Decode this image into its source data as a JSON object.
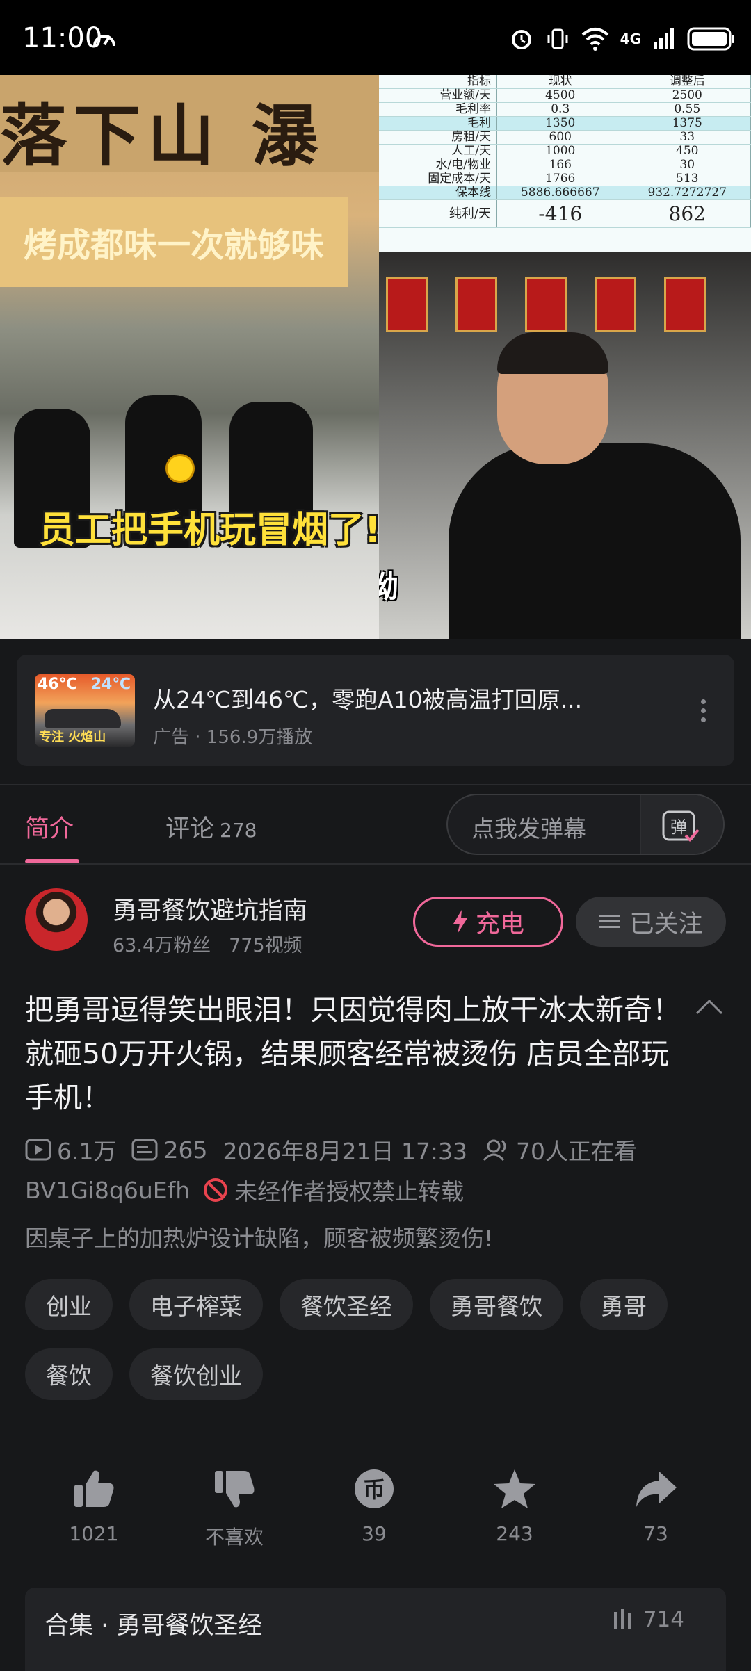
{
  "status_bar": {
    "time": "11:00",
    "network": "4G"
  },
  "video": {
    "left_sign_text": "落下山 瀑",
    "left_banner_text": "烤成都味一次就够味",
    "left_subtitle": "员工把手机玩冒烟了!",
    "right_caption": "哎呦",
    "table": {
      "headers": [
        "指标",
        "现状",
        "调整后"
      ],
      "rows": [
        [
          "营业额/天",
          "4500",
          "2500"
        ],
        [
          "毛利率",
          "0.3",
          "0.55"
        ],
        [
          "毛利",
          "1350",
          "1375"
        ],
        [
          "房租/天",
          "600",
          "33"
        ],
        [
          "人工/天",
          "1000",
          "450"
        ],
        [
          "水/电/物业",
          "166",
          "30"
        ],
        [
          "固定成本/天",
          "1766",
          "513"
        ],
        [
          "保本线",
          "5886.666667",
          "932.7272727"
        ],
        [
          "纯利/天",
          "-416",
          "862"
        ]
      ]
    }
  },
  "ad": {
    "thumb_temp_hot": "46℃",
    "thumb_temp_cool": "24℃",
    "thumb_caption": "专注 火焰山",
    "title": "从24℃到46℃，零跑A10被高温打回原...",
    "subtitle": "广告 · 156.9万播放"
  },
  "tabs": {
    "intro": "简介",
    "comments": "评论",
    "comments_count": "278",
    "danmu_placeholder": "点我发弹幕"
  },
  "author": {
    "name": "勇哥餐饮避坑指南",
    "fans": "63.4万粉丝",
    "videos": "775视频",
    "charge_label": "充电",
    "follow_label": "已关注"
  },
  "video_info": {
    "title": "把勇哥逗得笑出眼泪！只因觉得肉上放干冰太新奇！就砸50万开火锅，结果顾客经常被烫伤 店员全部玩手机！",
    "views": "6.1万",
    "danmaku": "265",
    "datetime": "2026年8月21日 17:33",
    "watching": "70人正在看",
    "bvid": "BV1Gi8q6uEfh",
    "copyright": "未经作者授权禁止转载",
    "description": "因桌子上的加热炉设计缺陷，顾客被频繁烫伤!"
  },
  "tags": [
    "创业",
    "电子榨菜",
    "餐饮圣经",
    "勇哥餐饮",
    "勇哥",
    "餐饮",
    "餐饮创业"
  ],
  "actions": {
    "like": "1021",
    "dislike": "不喜欢",
    "coin": "39",
    "favorite": "243",
    "share": "73"
  },
  "collection": {
    "title": "合集 · 勇哥餐饮圣经",
    "count": "714"
  },
  "colors": {
    "accent": "#f0689a",
    "background": "#17181a"
  },
  "icons": [
    "speedometer-icon",
    "alarm-icon",
    "vibrate-icon",
    "wifi-icon",
    "signal-icon",
    "battery-icon",
    "more-icon",
    "danmu-icon",
    "bolt-icon",
    "menu-icon",
    "chevron-up-icon",
    "play-icon",
    "danmaku-count-icon",
    "watching-icon",
    "forbidden-icon",
    "thumb-up-icon",
    "thumb-down-icon",
    "coin-icon",
    "star-icon",
    "share-icon",
    "bars-icon"
  ]
}
